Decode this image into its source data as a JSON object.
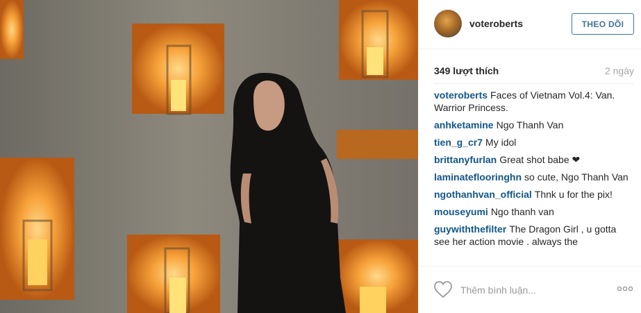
{
  "post": {
    "username": "voteroberts",
    "follow_label": "THEO DÕI",
    "likes": "349 lượt thích",
    "age": "2 ngày",
    "comments": [
      {
        "user": "voteroberts",
        "text": "Faces of Vietnam Vol.4: Van. Warrior Princess."
      },
      {
        "user": "anhketamine",
        "text": "Ngo Thanh Van"
      },
      {
        "user": "tien_g_cr7",
        "text": "My idol"
      },
      {
        "user": "brittanyfurlan",
        "text": "Great shot babe ❤"
      },
      {
        "user": "laminateflooringhn",
        "text": "so cute, Ngo Thanh Van"
      },
      {
        "user": "ngothanhvan_official",
        "text": "Thnk u for the pix!"
      },
      {
        "user": "mouseyumi",
        "text": "Ngo thanh van "
      },
      {
        "user": "guywiththefilter",
        "text": "The Dragon Girl , u gotta see her action movie . always the"
      }
    ],
    "add_comment_placeholder": "Thêm bình luận...",
    "icons": {
      "like": "heart-outline-icon",
      "more": "more-options-icon"
    },
    "colors": {
      "username": "#125688",
      "follow": "#3f729b",
      "muted": "#a5a7aa"
    }
  }
}
